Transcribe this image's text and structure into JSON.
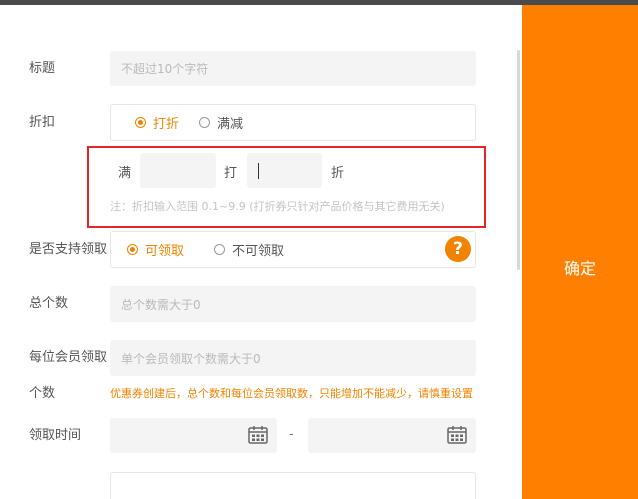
{
  "form": {
    "title": {
      "label": "标题",
      "placeholder": "不超过10个字符"
    },
    "discount": {
      "label": "折扣",
      "options": [
        "打折",
        "满减"
      ],
      "selected": "打折",
      "man_label": "满",
      "da_label": "打",
      "zhe_label": "折",
      "hint": "注：折扣输入范围 0.1~9.9 (打折券只针对产品价格与其它费用无关)"
    },
    "claim": {
      "label": "是否支持领取",
      "options": [
        "可领取",
        "不可领取"
      ],
      "selected": "可领取",
      "help": "?"
    },
    "total": {
      "label": "总个数",
      "placeholder": "总个数需大于0"
    },
    "per_member": {
      "label_line1": "每位会员领取",
      "label_line2": "个数",
      "placeholder": "单个会员领取个数需大于0",
      "warning": "优惠券创建后，总个数和每位会员领取数，只能增加不能减少，请慎重设置"
    },
    "claim_time": {
      "label": "领取时间",
      "separator": "-"
    }
  },
  "sidebar": {
    "confirm_label": "确定"
  },
  "colors": {
    "accent": "#f08300",
    "sidebar": "#ff8000",
    "highlight_border": "#e0262b"
  },
  "icons": [
    "help-icon",
    "calendar-icon"
  ]
}
